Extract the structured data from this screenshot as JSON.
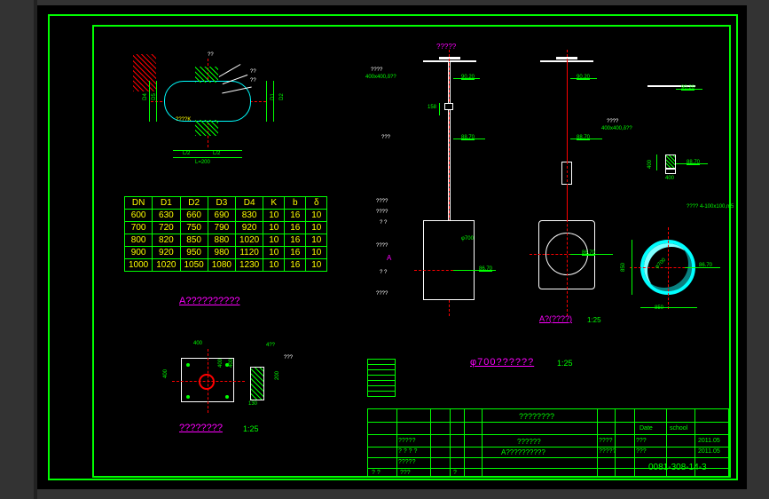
{
  "drawing": {
    "detail_a": {
      "callout1": "??",
      "callout2": "??",
      "label_inside": "????K",
      "dim_d1": "D1",
      "dim_d2": "D2",
      "dim_d4": "D4",
      "dim_d5": "D5",
      "dim_l2a": "L/2",
      "dim_l2b": "L/2",
      "dim_l": "L=200",
      "title": "A??????????"
    },
    "table": {
      "headers": [
        "DN",
        "D1",
        "D2",
        "D3",
        "D4",
        "K",
        "b",
        "δ"
      ],
      "rows": [
        [
          "600",
          "630",
          "660",
          "690",
          "830",
          "10",
          "16",
          "10"
        ],
        [
          "700",
          "720",
          "750",
          "790",
          "920",
          "10",
          "16",
          "10"
        ],
        [
          "800",
          "820",
          "850",
          "880",
          "1020",
          "10",
          "16",
          "10"
        ],
        [
          "900",
          "920",
          "950",
          "980",
          "1120",
          "10",
          "16",
          "10"
        ],
        [
          "1000",
          "1020",
          "1050",
          "1080",
          "1230",
          "10",
          "16",
          "10"
        ]
      ]
    },
    "baseplate": {
      "dim_400_top": "400",
      "dim_400_left": "400",
      "dim_400_mid": "400",
      "dim_400_mid2": "400",
      "dim_200": "200",
      "dim_130": "130",
      "dim_bolt": "4??",
      "dim_pipe": "???",
      "title": "????????",
      "scale": "1:25"
    },
    "elev1": {
      "top_label": "?????",
      "cap_label": "????",
      "cap_sub": "400x400,δ??",
      "dim_90_20_a": "90.20",
      "dim_158": "158",
      "mid_label": "???",
      "dim_88_70_a": "88.70",
      "annot1": "????",
      "annot2": "????",
      "annot3": "? ?",
      "annot4": "????",
      "annot_A": "A",
      "annot5": "? ?",
      "annot6": "????",
      "dim_phi700": "φ700",
      "dim_86_70_a": "86.70"
    },
    "elev2": {
      "dim_90_20_b": "90.20",
      "dim_88_70_b": "88.70",
      "dim_86_70_b": "86.70",
      "footer_label": "A?(????)",
      "footer_scale": "1:25"
    },
    "elev3": {
      "dim_90_20_c": "90.20",
      "cap_label": "????",
      "cap_sub": "400x400,δ??",
      "dim_88_70_c": "88.70",
      "dim_400_v": "400",
      "dim_400_h": "400",
      "ring_phi": "φ700",
      "ring_bolt": "????\n4-100x100,m5",
      "dim_86_70_c": "86.70",
      "dim_850_v": "850",
      "dim_850_h": "850"
    },
    "main_title": "φ700??????",
    "main_scale": "1:25"
  },
  "titleblock": {
    "big_title": "????????",
    "subtitle1": "??????",
    "subtitle2": "A??????????",
    "dwg_no": "0081-308-14-3",
    "col_labels": [
      "?????",
      "? ? ? ?",
      "?????",
      "? ?",
      "???",
      "?"
    ],
    "small1": "????",
    "small2": "?????",
    "r_dates": [
      "2011.05",
      "2011.05"
    ],
    "r_names": [
      "???",
      "???"
    ],
    "r_hdr1": "Date",
    "r_hdr2": "school"
  },
  "colors": {
    "frame": "#00ff00",
    "dim": "#00ff00",
    "text_label": "#ffff00",
    "part": "#ffffff",
    "center": "#ff0000",
    "accent": "#00ffff"
  }
}
